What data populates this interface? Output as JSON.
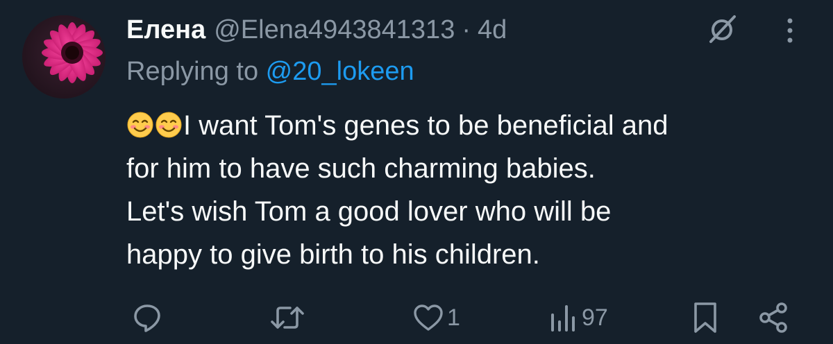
{
  "tweet": {
    "display_name": "Елена",
    "handle": "@Elena4943841313",
    "separator": "·",
    "timestamp": "4d",
    "replying_prefix": "Replying to ",
    "replying_to": "@20_lokeen",
    "text_lines": [
      "I want Tom's genes to be beneficial and",
      "for him to have such charming babies.",
      "Let's wish Tom a good lover who will be",
      "happy to give birth to his children."
    ],
    "leading_emojis": [
      "smiling-face-icon",
      "smiling-face-icon"
    ]
  },
  "actions": {
    "reply": {
      "icon": "reply-icon",
      "count": ""
    },
    "retweet": {
      "icon": "retweet-icon",
      "count": ""
    },
    "like": {
      "icon": "heart-icon",
      "count": "1"
    },
    "views": {
      "icon": "views-icon",
      "count": "97"
    },
    "bookmark": {
      "icon": "bookmark-icon"
    },
    "share": {
      "icon": "share-icon"
    }
  },
  "colors": {
    "background": "#15202b",
    "text_primary": "#f7f9f9",
    "text_secondary": "#8b98a5",
    "accent": "#1d9bf0"
  }
}
